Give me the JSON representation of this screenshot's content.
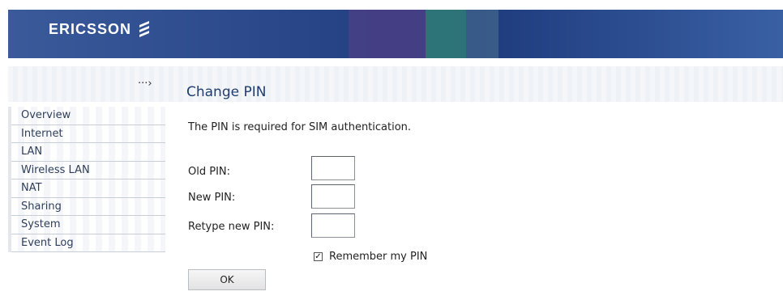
{
  "brand": {
    "name": "ERICSSON",
    "logo_icon": "ericsson-stripes-icon"
  },
  "breadcrumb_arrow": "···›",
  "page": {
    "title": "Change PIN",
    "description": "The PIN is required for SIM authentication."
  },
  "sidebar": {
    "items": [
      {
        "label": "Overview"
      },
      {
        "label": "Internet"
      },
      {
        "label": "LAN"
      },
      {
        "label": "Wireless LAN"
      },
      {
        "label": "NAT"
      },
      {
        "label": "Sharing"
      },
      {
        "label": "System"
      },
      {
        "label": "Event Log"
      }
    ]
  },
  "form": {
    "old_pin_label": "Old PIN:",
    "old_pin_value": "",
    "new_pin_label": "New PIN:",
    "new_pin_value": "",
    "retype_pin_label": "Retype new PIN:",
    "retype_pin_value": "",
    "remember_label": "Remember my PIN",
    "remember_checked": true,
    "ok_label": "OK"
  },
  "colors": {
    "banner": "#2c4a8c",
    "title": "#1f3d6e",
    "sidebar_text": "#2e3e5a"
  }
}
